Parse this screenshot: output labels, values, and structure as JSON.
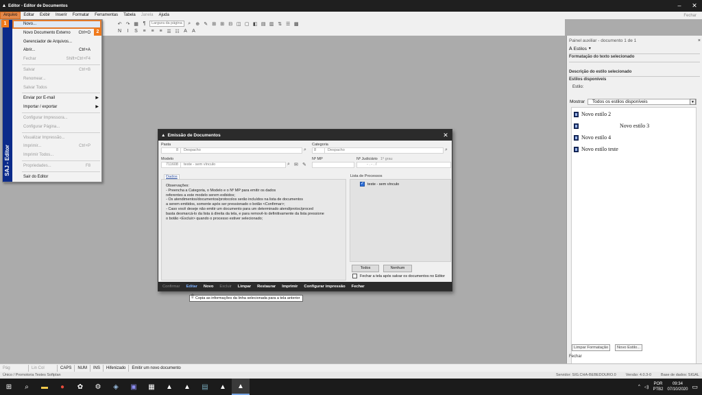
{
  "window": {
    "title": "Editor - Editor de Documentos",
    "minimize": "–",
    "close": "✕"
  },
  "menu": {
    "items": [
      "Arquivo",
      "Editar",
      "Exibir",
      "Inserir",
      "Formatar",
      "Ferramentas",
      "Tabela",
      "Janela",
      "Ajuda"
    ],
    "close_doc": "Fechar"
  },
  "toolbar": {
    "zoom_combo": "Largura da página"
  },
  "file_menu": {
    "strip_label": "SAJ - Editor",
    "items": [
      {
        "label": "Novo...",
        "shortcut": "",
        "disabled": false
      },
      {
        "label": "Novo Documento Externo",
        "shortcut": "Ctrl+O",
        "disabled": false
      },
      {
        "label": "Gerenciador de Arquivos...",
        "shortcut": "",
        "disabled": false
      },
      {
        "label": "Abrir...",
        "shortcut": "Ctrl+A",
        "disabled": false
      },
      {
        "label": "Fechar",
        "shortcut": "Shift+Ctrl+F4",
        "disabled": true
      },
      {
        "label": "Salvar",
        "shortcut": "Ctrl+B",
        "disabled": true
      },
      {
        "label": "Renomear...",
        "shortcut": "",
        "disabled": true
      },
      {
        "label": "Salvar Todos",
        "shortcut": "",
        "disabled": true
      },
      {
        "label": "Enviar por E-mail",
        "shortcut": "",
        "disabled": false
      },
      {
        "label": "Importar / exportar",
        "shortcut": "",
        "disabled": false
      },
      {
        "label": "Configurar Impressora...",
        "shortcut": "",
        "disabled": true
      },
      {
        "label": "Configurar Página...",
        "shortcut": "",
        "disabled": true
      },
      {
        "label": "Visualizar Impressão...",
        "shortcut": "",
        "disabled": true
      },
      {
        "label": "Imprimir...",
        "shortcut": "Ctrl+P",
        "disabled": true
      },
      {
        "label": "Imprimir Todos...",
        "shortcut": "",
        "disabled": true
      },
      {
        "label": "Propriedades...",
        "shortcut": "F8",
        "disabled": true
      },
      {
        "label": "Sair do Editor",
        "shortcut": "",
        "disabled": false
      }
    ]
  },
  "badges": {
    "one": "1",
    "two": "2"
  },
  "panel": {
    "header": "Painel auxiliar - documento 1 de 1",
    "close": "×",
    "tab": "Estilos",
    "section_format": "Formatação do texto selecionado",
    "section_desc": "Descrição do estilo selecionado",
    "section_available": "Estilos disponíveis",
    "style_label": "Estilo:",
    "show_label": "Mostrar",
    "show_value": "Todos os estilos disponíveis",
    "styles": [
      "Novo estilo 2",
      "Novo estilo 3",
      "Novo estilo 4",
      "Novo estilo teste"
    ],
    "btn_clear": "Limpar Formatação",
    "btn_new": "Novo Estilo...",
    "footer": "Fechar"
  },
  "dialog": {
    "title": "Emissão de Documentos",
    "close": "✕",
    "pasta_label": "Pasta",
    "pasta_num": "8",
    "pasta_text": "Despacho",
    "categoria_label": "Categoria",
    "categoria_num": "8",
    "categoria_text": "Despacho",
    "modelo_label": "Modelo",
    "modelo_num": "711608",
    "modelo_text": "teste - sem vínculo",
    "nmp_label": "Nº MP",
    "njud_label": "Nº Judiciário",
    "grau_label": "1º grau",
    "njud_value": "- . - . /",
    "tab_dados": "Dados",
    "observacoes": "Observações:\n - Preencha a Categoria, o Modelo e o Nº MP para emitir os dados\nreferentes a este modelo serem exibidos;\n - Os atendimentos/documentos/protocolos serão incluídos na lista de documentos\na serem emitidos, somente após ser pressionado o botão <Confirmar>;\n - Caso você deseje não emitir um documento para um determinado atend/protoc/proced\nbasta desmarcá-lo da lista à direita da tela, e para removê-lo definitivamente da lista pressione\no botão <Excluir> quando o processo estiver selecionado;",
    "list_title": "Lista de Processos",
    "list_item": "teste - sem vínculo",
    "btn_todos": "Todos",
    "btn_nenhum": "Nenhum",
    "close_after": "Fechar a tela após salvar os documentos no Editor",
    "actions": [
      {
        "label": "Confirmar",
        "state": "dis"
      },
      {
        "label": "Editar",
        "state": "edit"
      },
      {
        "label": "Novo",
        "state": ""
      },
      {
        "label": "Excluir",
        "state": "dis"
      },
      {
        "label": "Limpar",
        "state": ""
      },
      {
        "label": "Restaurar",
        "state": ""
      },
      {
        "label": "Imprimir",
        "state": ""
      },
      {
        "label": "Configurar impressão",
        "state": ""
      },
      {
        "label": "Fechar",
        "state": ""
      }
    ]
  },
  "tooltip": "Copia as informações da linha selecionada para a tela anterior",
  "status": {
    "items": [
      "Pág",
      "Lin  Col",
      "CAPS",
      "NUM",
      "INS",
      "Hifenizado",
      "Emitir um novo documento"
    ]
  },
  "info": {
    "left": "Único / Promotoria Testes Softplan",
    "server": "Servidor: SIG.CHA-BEBEDOURO.0",
    "version": "Versão: 4.0.3-0",
    "db": "Base de dados: SIGAL"
  },
  "taskbar": {
    "lang": "POR",
    "layout": "PTB2",
    "time": "09:34",
    "date": "07/10/2020"
  }
}
